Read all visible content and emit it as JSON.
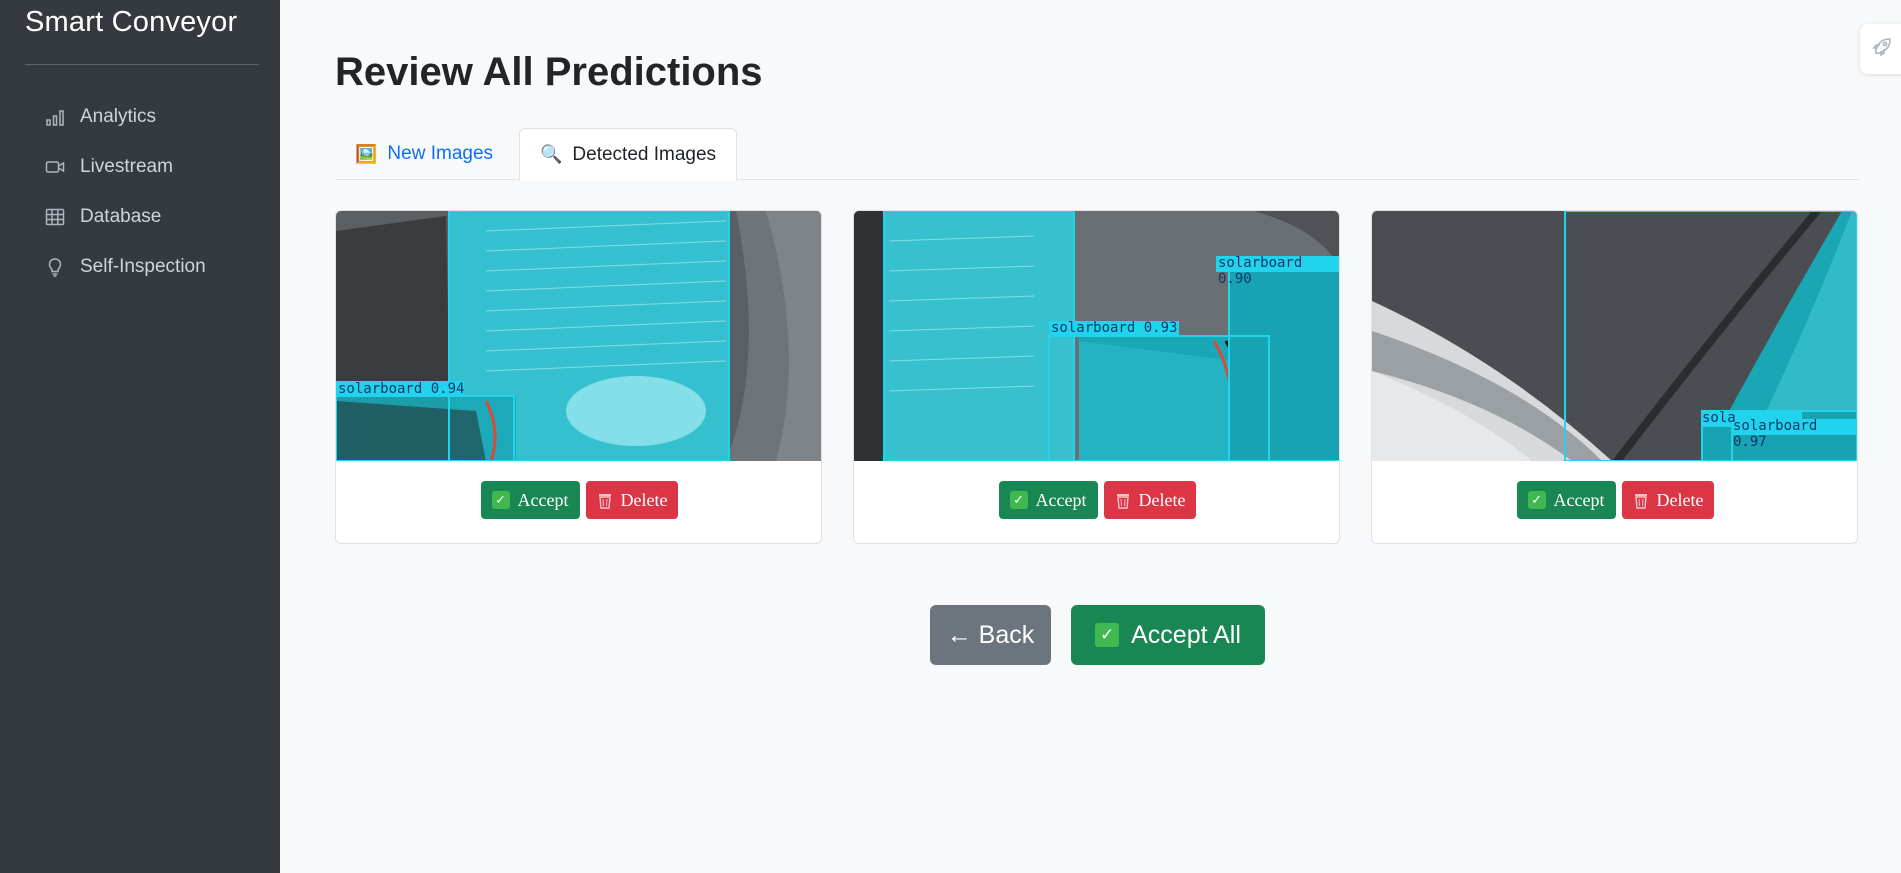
{
  "sidebar": {
    "brand": "Smart Conveyor",
    "items": [
      {
        "label": "Analytics",
        "icon": "bar-chart-icon"
      },
      {
        "label": "Livestream",
        "icon": "camera-video-icon"
      },
      {
        "label": "Database",
        "icon": "table-icon"
      },
      {
        "label": "Self-Inspection",
        "icon": "lightbulb-icon"
      }
    ]
  },
  "main": {
    "title": "Review All Predictions",
    "tabs": [
      {
        "label": "New Images",
        "icon": "🖼️",
        "active": false
      },
      {
        "label": "Detected Images",
        "icon": "🔍",
        "active": true
      }
    ],
    "cards": [
      {
        "detections": [
          {
            "label": "solarboard 0.94"
          }
        ],
        "accept_label": "Accept",
        "delete_label": "Delete"
      },
      {
        "detections": [
          {
            "label": "solarboard 0.90"
          },
          {
            "label": "solarboard 0.93"
          }
        ],
        "accept_label": "Accept",
        "delete_label": "Delete"
      },
      {
        "detections": [
          {
            "label": "sola"
          },
          {
            "label": "solarboard 0.97"
          }
        ],
        "accept_label": "Accept",
        "delete_label": "Delete"
      }
    ],
    "back_label": "← Back",
    "accept_all_label": "Accept All"
  },
  "colors": {
    "sidebar_bg": "#343a40",
    "accent_blue": "#0d6efd",
    "success": "#198754",
    "danger": "#dc3545",
    "secondary": "#6c757d",
    "detection_cyan": "#22d3ee"
  }
}
